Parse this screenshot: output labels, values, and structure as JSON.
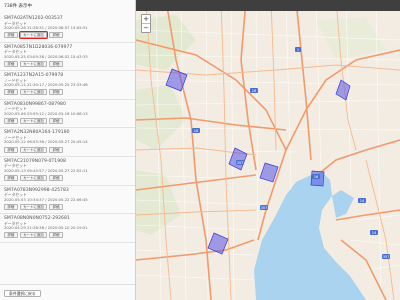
{
  "sidebar": {
    "header": "738件 表示中",
    "footer_button": "条件選択に戻る",
    "items": [
      {
        "id": "SM7A02ATN1202-003537",
        "type": "データセット",
        "date": "2020.05.26 21:28:31 / 2020.06.07 13:05:51",
        "btn1": "詳細",
        "btn2": "カートに追加",
        "btn3": "詳細"
      },
      {
        "id": "SM7A0857N1D28036-079977",
        "type": "データセット",
        "date": "2020.05.25 03:05:38 / 2020.06.02 15:43:33",
        "btn1": "詳細",
        "btn2": "カートに追加",
        "btn3": "詳細"
      },
      {
        "id": "SM7A1237N2A15-079978",
        "type": "ノードセット",
        "date": "2020.05.11 21:30:17 / 2020.05.25 23:33:46",
        "btn1": "詳細",
        "btn2": "カートに追加",
        "btn3": "詳細"
      },
      {
        "id": "SM7A0830N99867-087980",
        "type": "ノードセット",
        "date": "2020.05.06 03:55:12 / 2020.05.16 10:08:13",
        "btn1": "詳細",
        "btn2": "カートに追加",
        "btn3": "詳細"
      },
      {
        "id": "SM7A2N32N80A164-179180",
        "type": "ノードセット",
        "date": "2020.05.12 06:55:36 / 2020.05.27 20:45:14",
        "btn1": "詳細",
        "btn2": "カートに追加",
        "btn3": "詳細"
      },
      {
        "id": "SM7AC21079N079-0T1908",
        "type": "データセット",
        "date": "2020.05.13 09:45:57 / 2020.05.27 22:02:11",
        "btn1": "詳細",
        "btn2": "カートに追加",
        "btn3": "詳細"
      },
      {
        "id": "SM7A0783N992998-425783",
        "type": "データセット",
        "date": "2020.05.03 10:34:37 / 2020.05.22 22:06:45",
        "btn1": "詳細",
        "btn2": "カートに追加",
        "btn3": "詳細"
      },
      {
        "id": "SM7A08N0N0N0752-292681",
        "type": "データセット",
        "date": "2020.04.29 21:28:36 / 2020.05.10 20:19:51",
        "btn1": "詳細",
        "btn2": "カートに追加",
        "btn3": "詳細"
      }
    ]
  },
  "map": {
    "zoom_in": "+",
    "zoom_out": "−",
    "footprint_color": "#5555e6",
    "route_labels": [
      "16",
      "357",
      "1",
      "16",
      "357",
      "16",
      "14",
      "357",
      "14"
    ]
  },
  "colors": {
    "water": "#a9d3ee",
    "land": "#f3ece2",
    "road_major": "#f29a6c",
    "topbar": "#3f3f3f",
    "highlight": "#e02020"
  }
}
